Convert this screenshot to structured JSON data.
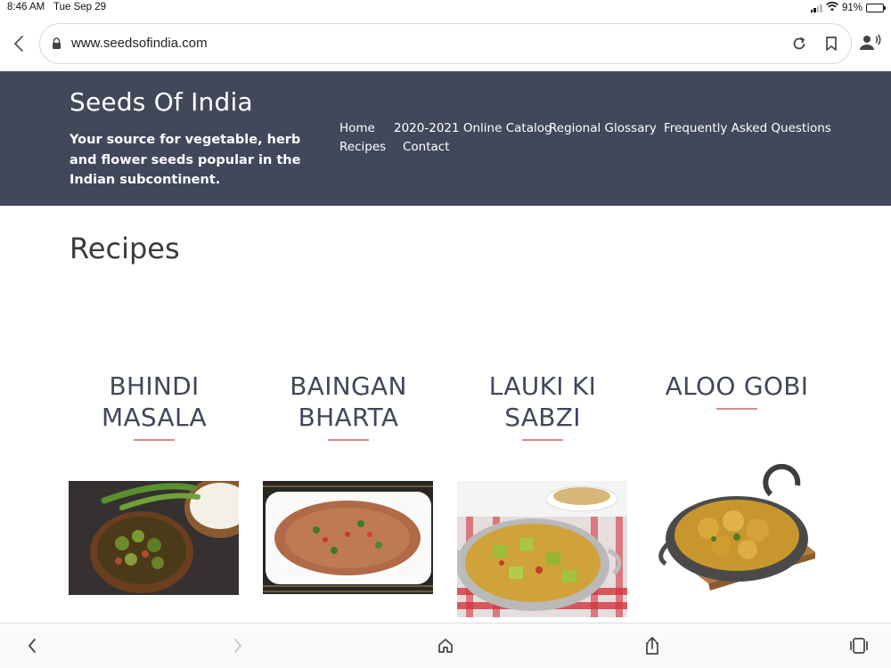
{
  "status_bar": {
    "time": "8:46 AM",
    "date": "Tue Sep 29",
    "battery": "91%",
    "battery_level": 0.91,
    "icons": [
      "cellular-signal-icon",
      "wifi-icon",
      "battery-icon"
    ]
  },
  "browser": {
    "url": "www.seedsofindia.com",
    "icons": [
      "back-icon",
      "lock-icon",
      "reload-icon",
      "bookmark-icon",
      "reader-icon"
    ]
  },
  "site": {
    "title": "Seeds Of India",
    "tagline": "Your source for vegetable, herb and flower seeds popular in the Indian subcontinent.",
    "nav": [
      "Home",
      "2020-2021 Online Catalog",
      "Regional Glossary",
      "Frequently Asked Questions",
      "Recipes",
      "Contact"
    ]
  },
  "page": {
    "heading": "Recipes"
  },
  "recipes": [
    {
      "title": "BHINDI MASALA"
    },
    {
      "title": "BAINGAN BHARTA"
    },
    {
      "title": "LAUKI KI SABZI"
    },
    {
      "title": "ALOO GOBI"
    }
  ],
  "toolbar": {
    "icons": [
      "back-icon",
      "forward-icon",
      "home-icon",
      "share-icon",
      "tabs-icon"
    ]
  },
  "colors": {
    "header_bg": "#414859",
    "accent_underline": "#d98b88",
    "heading_text": "#414859"
  }
}
